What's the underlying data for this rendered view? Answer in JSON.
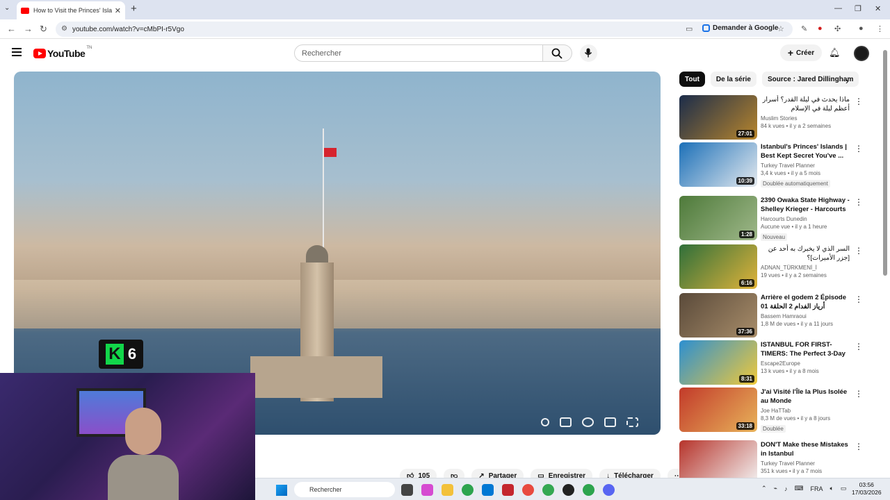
{
  "browser": {
    "tab_title": "How to Visit the Princes' Islands",
    "url": "youtube.com/watch?v=cMbPI-r5Vgo",
    "ask_google": "Demander à Google"
  },
  "youtube": {
    "logo_text": "YouTube",
    "region": "TN",
    "search_placeholder": "Rechercher",
    "create_label": "Créer"
  },
  "video": {
    "channel_number": "6",
    "actions": {
      "likes": "105",
      "share": "Partager",
      "save": "Enregistrer",
      "download": "Télécharger"
    }
  },
  "chips": [
    "Tout",
    "De la série",
    "Source : Jared Dillingham"
  ],
  "recommendations": [
    {
      "title": "ماذا يحدث في ليلة القدر؟ أسرار أعظم ليلة في الإسلام",
      "rtl": true,
      "channel": "Muslim Stories",
      "meta": "84 k vues • il y a 2 semaines",
      "badge": "",
      "duration": "27:01",
      "color_a": "#1b2c4a",
      "color_b": "#b8862d"
    },
    {
      "title": "Istanbul's Princes' Islands | Best Kept Secret You've ...",
      "rtl": false,
      "channel": "Turkey Travel Planner",
      "meta": "3,4 k vues • il y a 5 mois",
      "badge": "Doublée automatiquement",
      "duration": "10:39",
      "color_a": "#1c70b8",
      "color_b": "#e4e9ee"
    },
    {
      "title": "2390 Owaka State Highway - Shelley Krieger - Harcourts",
      "rtl": false,
      "channel": "Harcourts Dunedin",
      "meta": "Aucune vue • il y a 1 heure",
      "badge": "Nouveau",
      "duration": "1:28",
      "color_a": "#4e7a3a",
      "color_b": "#9fb88a"
    },
    {
      "title": "السر الذي لا يخبرك به أحد عن [جزر الأميرات]؟",
      "rtl": true,
      "channel": "ADNAN_TÜRKMENİ_İ",
      "meta": "19 vues • il y a 2 semaines",
      "badge": "",
      "duration": "6:16",
      "color_a": "#2f6f3a",
      "color_b": "#e0b33a"
    },
    {
      "title": "Arrière el godem 2 Épisode 01 أرياز الفدام 2 الحلقة",
      "rtl": false,
      "channel": "Bassem Hamraoui",
      "meta": "1,8 M de vues • il y a 11 jours",
      "badge": "",
      "duration": "37:36",
      "color_a": "#5a4a3a",
      "color_b": "#a88d6a"
    },
    {
      "title": "ISTANBUL FOR FIRST-TIMERS: The Perfect 3-Day ...",
      "rtl": false,
      "channel": "Escape2Europe",
      "meta": "13 k vues • il y a 8 mois",
      "badge": "",
      "duration": "8:31",
      "color_a": "#2c8fd1",
      "color_b": "#f0c93a"
    },
    {
      "title": "J'ai Visité l'Île la Plus Isolée au Monde",
      "rtl": false,
      "channel": "Joe HaTTab",
      "meta": "8,3 M de vues • il y a 8 jours",
      "badge": "Doublée",
      "duration": "33:18",
      "color_a": "#c23a2a",
      "color_b": "#e8b35a"
    },
    {
      "title": "DON'T Make these Mistakes in Istanbul",
      "rtl": false,
      "channel": "Turkey Travel Planner",
      "meta": "351 k vues • il y a 7 mois",
      "badge": "",
      "duration": "",
      "color_a": "#b6332a",
      "color_b": "#f3f3f3"
    }
  ],
  "taskbar": {
    "search": "Rechercher",
    "lang": "FRA",
    "time": "03:56",
    "date": "17/03/2026"
  }
}
